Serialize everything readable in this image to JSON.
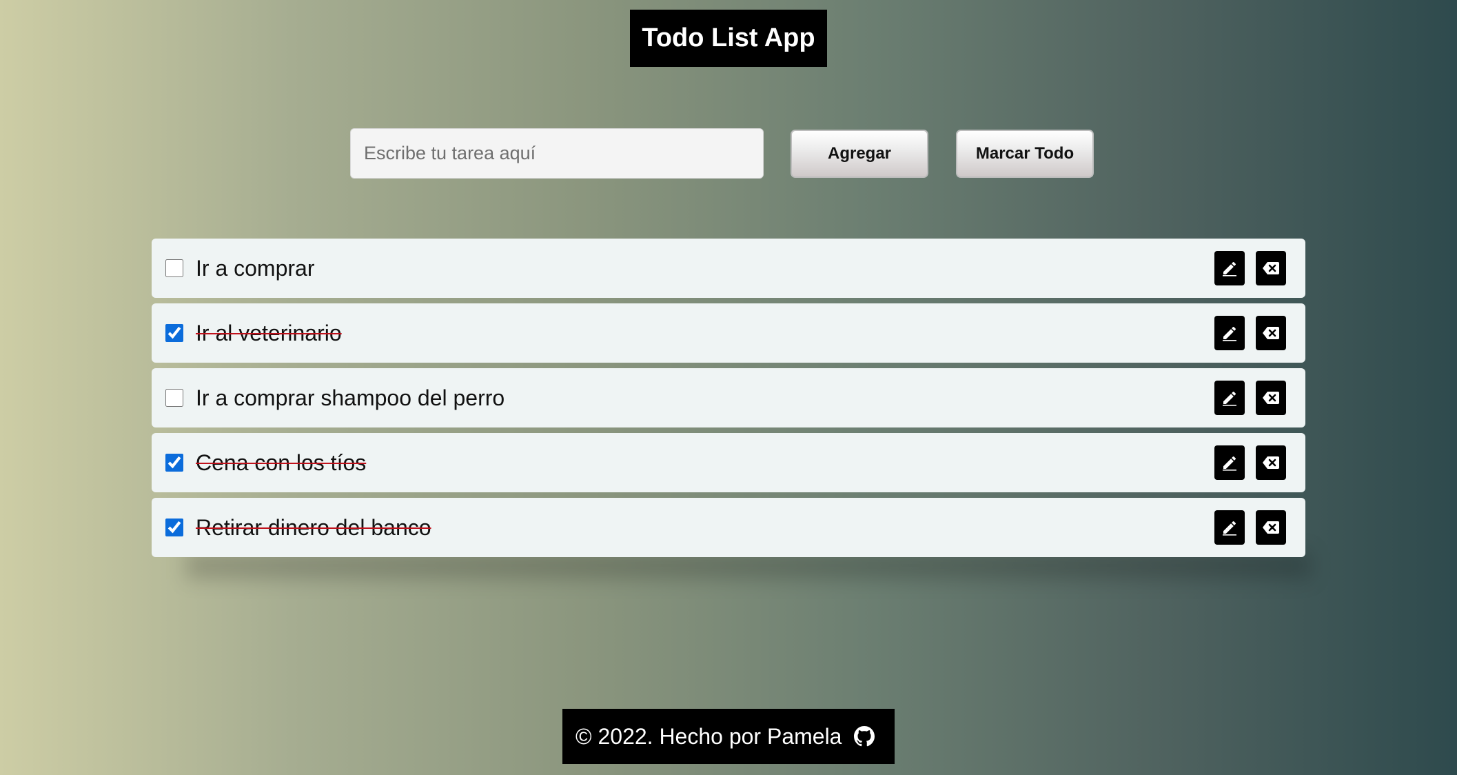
{
  "header": {
    "title": "Todo List App"
  },
  "form": {
    "placeholder": "Escribe tu tarea aquí",
    "value": "",
    "add_label": "Agregar",
    "mark_all_label": "Marcar Todo"
  },
  "todos": [
    {
      "text": "Ir a comprar",
      "done": false
    },
    {
      "text": "Ir al veterinario",
      "done": true
    },
    {
      "text": "Ir a comprar shampoo del perro",
      "done": false
    },
    {
      "text": "Cena con los tíos",
      "done": true
    },
    {
      "text": "Retirar dinero del banco",
      "done": true
    }
  ],
  "footer": {
    "text": "© 2022. Hecho por Pamela",
    "icon": "github-icon"
  },
  "colors": {
    "strike": "#c0111b",
    "checkbox_accent": "#0b6cdb",
    "gradient_start": "#cdcda5",
    "gradient_end": "#2e4a4d"
  }
}
